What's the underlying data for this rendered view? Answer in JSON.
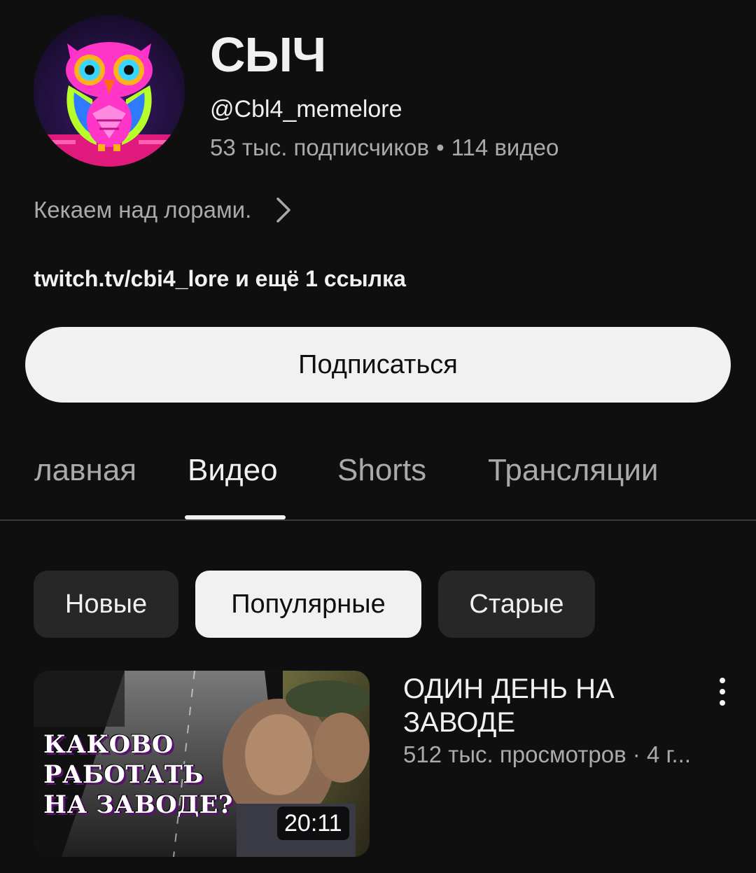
{
  "channel": {
    "name": "СЫЧ",
    "handle": "@Cbl4_memelore",
    "subscribers": "53 тыс. подписчиков",
    "separator": "•",
    "video_count": "114 видео",
    "description": "Кекаем над лорами.",
    "links": "twitch.tv/cbi4_lore и ещё 1 ссылка",
    "avatar_icon": "owl-avatar"
  },
  "subscribe": {
    "label": "Подписаться"
  },
  "tabs": [
    {
      "label": "Главная",
      "visible_label": "лавная",
      "active": false
    },
    {
      "label": "Видео",
      "active": true
    },
    {
      "label": "Shorts",
      "active": false
    },
    {
      "label": "Трансляции",
      "active": false
    }
  ],
  "chips": [
    {
      "label": "Новые",
      "selected": false
    },
    {
      "label": "Популярные",
      "selected": true
    },
    {
      "label": "Старые",
      "selected": false
    }
  ],
  "videos": [
    {
      "title": "ОДИН ДЕНЬ НА ЗАВОДЕ",
      "meta": "512 тыс. просмотров · 4 г...",
      "duration": "20:11",
      "thumbnail_text": [
        "КАКОВО",
        "РАБОТАТЬ",
        "НА ЗАВОДЕ?"
      ]
    }
  ],
  "colors": {
    "background": "#0f0f0f",
    "text_primary": "#f1f1f1",
    "text_secondary": "#aaaaaa",
    "chip_bg": "#272727",
    "button_bg": "#f1f1f1"
  }
}
